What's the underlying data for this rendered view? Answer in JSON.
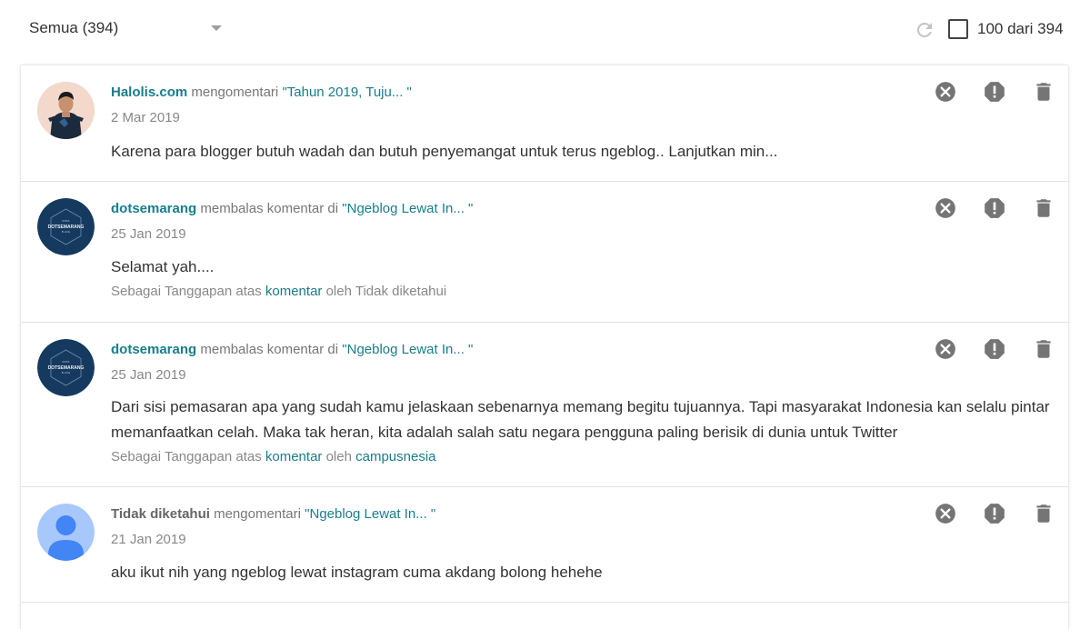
{
  "toolbar": {
    "filter_label": "Semua (394)",
    "count_label": "100 dari 394"
  },
  "comments": [
    {
      "author": "Halolis.com",
      "verb": "mengomentari",
      "post": "\"Tahun 2019, Tuju... \"",
      "date": "2 Mar 2019",
      "text": "Karena para blogger butuh wadah dan butuh penyemangat untuk terus ngeblog.. Lanjutkan min...",
      "avatar": "photo"
    },
    {
      "author": "dotsemarang",
      "verb": "membalas komentar di",
      "post": "\"Ngeblog Lewat In... \"",
      "date": "25 Jan 2019",
      "text": "Selamat yah....",
      "reply_prefix": "Sebagai Tanggapan atas",
      "reply_link": "komentar",
      "reply_by": "oleh",
      "reply_author": "Tidak diketahui",
      "avatar": "logo"
    },
    {
      "author": "dotsemarang",
      "verb": "membalas komentar di",
      "post": "\"Ngeblog Lewat In... \"",
      "date": "25 Jan 2019",
      "text": "Dari sisi pemasaran apa yang sudah kamu jelaskaan sebenarnya memang begitu tujuannya. Tapi masyarakat Indonesia kan selalu pintar memanfaatkan celah. Maka tak heran, kita adalah salah satu negara pengguna paling berisik di dunia untuk Twitter",
      "reply_prefix": "Sebagai Tanggapan atas",
      "reply_link": "komentar",
      "reply_by": "oleh",
      "reply_author": "campusnesia",
      "avatar": "logo"
    },
    {
      "author": "Tidak diketahui",
      "verb": "mengomentari",
      "post": "\"Ngeblog Lewat In... \"",
      "date": "21 Jan 2019",
      "text": "aku ikut nih yang ngeblog lewat instagram cuma akdang bolong hehehe",
      "avatar": "default"
    }
  ],
  "logo_text": {
    "top": "KOTA",
    "main": "DOTSEMARANG",
    "sub": "B LOG"
  },
  "colors": {
    "accent": "#1a7d8a",
    "logo_bg": "#163a5f",
    "default_avatar_bg": "#a8c7fa",
    "default_avatar_fg": "#4285f4",
    "icon": "#757575"
  },
  "icons": {
    "refresh": "refresh-icon",
    "dropdown": "chevron-down-icon",
    "remove": "remove-circle-icon",
    "spam": "spam-icon",
    "delete": "trash-icon"
  }
}
